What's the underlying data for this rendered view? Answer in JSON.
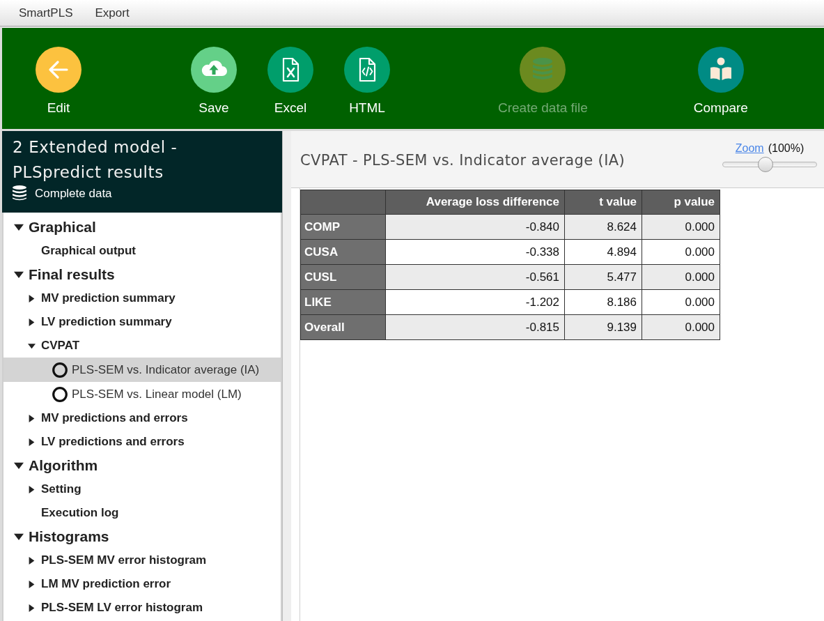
{
  "menu": [
    "SmartPLS",
    "Export"
  ],
  "toolbar": {
    "buttons": [
      {
        "kind": "back",
        "label": "Edit",
        "disabled": false
      },
      {
        "kind": "save",
        "label": "Save",
        "disabled": false
      },
      {
        "kind": "excel",
        "label": "Excel",
        "disabled": false
      },
      {
        "kind": "html",
        "label": "HTML",
        "disabled": false
      },
      {
        "kind": "database",
        "label": "Create data file",
        "disabled": true
      },
      {
        "kind": "compare",
        "label": "Compare",
        "disabled": false
      }
    ]
  },
  "sidebar": {
    "title": "2 Extended model - PLSpredict results",
    "dataset": "Complete data",
    "tree": [
      {
        "kind": "folder",
        "label": "Graphical",
        "expanded": true,
        "selected": false,
        "children": [
          {
            "kind": "leaf",
            "label": "Graphical output",
            "selected": false
          }
        ]
      },
      {
        "kind": "folder",
        "label": "Final results",
        "expanded": true,
        "selected": false,
        "children": [
          {
            "kind": "folder",
            "label": "MV prediction summary",
            "expanded": false,
            "selected": false
          },
          {
            "kind": "folder",
            "label": "LV prediction summary",
            "expanded": false,
            "selected": false
          },
          {
            "kind": "folder",
            "label": "CVPAT",
            "expanded": true,
            "selected": false,
            "children": [
              {
                "kind": "option",
                "label": "PLS-SEM vs. Indicator average (IA)",
                "selected": true
              },
              {
                "kind": "option",
                "label": "PLS-SEM vs. Linear model (LM)",
                "selected": false
              }
            ]
          },
          {
            "kind": "folder",
            "label": "MV predictions and errors",
            "expanded": false,
            "selected": false
          },
          {
            "kind": "folder",
            "label": "LV predictions and errors",
            "expanded": false,
            "selected": false
          }
        ]
      },
      {
        "kind": "folder",
        "label": "Algorithm",
        "expanded": true,
        "selected": false,
        "children": [
          {
            "kind": "folder",
            "label": "Setting",
            "expanded": false,
            "selected": false
          },
          {
            "kind": "leaf",
            "label": "Execution log",
            "selected": false
          }
        ]
      },
      {
        "kind": "folder",
        "label": "Histograms",
        "expanded": true,
        "selected": false,
        "children": [
          {
            "kind": "folder",
            "label": "PLS-SEM MV error histogram",
            "expanded": false,
            "selected": false
          },
          {
            "kind": "folder",
            "label": "LM MV prediction error",
            "expanded": false,
            "selected": false
          },
          {
            "kind": "folder",
            "label": "PLS-SEM LV error histogram",
            "expanded": false,
            "selected": false
          }
        ]
      }
    ]
  },
  "main": {
    "title": "CVPAT - PLS-SEM vs. Indicator average (IA)",
    "zoom": {
      "link": "Zoom",
      "value": "(100%)",
      "level": 0.45
    },
    "table": {
      "columns": [
        "Average loss difference",
        "t value",
        "p value"
      ],
      "rows": [
        {
          "label": "COMP",
          "cells": [
            "-0.840",
            "8.624",
            "0.000"
          ]
        },
        {
          "label": "CUSA",
          "cells": [
            "-0.338",
            "4.894",
            "0.000"
          ]
        },
        {
          "label": "CUSL",
          "cells": [
            "-0.561",
            "5.477",
            "0.000"
          ]
        },
        {
          "label": "LIKE",
          "cells": [
            "-1.202",
            "8.186",
            "0.000"
          ]
        },
        {
          "label": "Overall",
          "cells": [
            "-0.815",
            "9.139",
            "0.000"
          ]
        }
      ]
    }
  }
}
